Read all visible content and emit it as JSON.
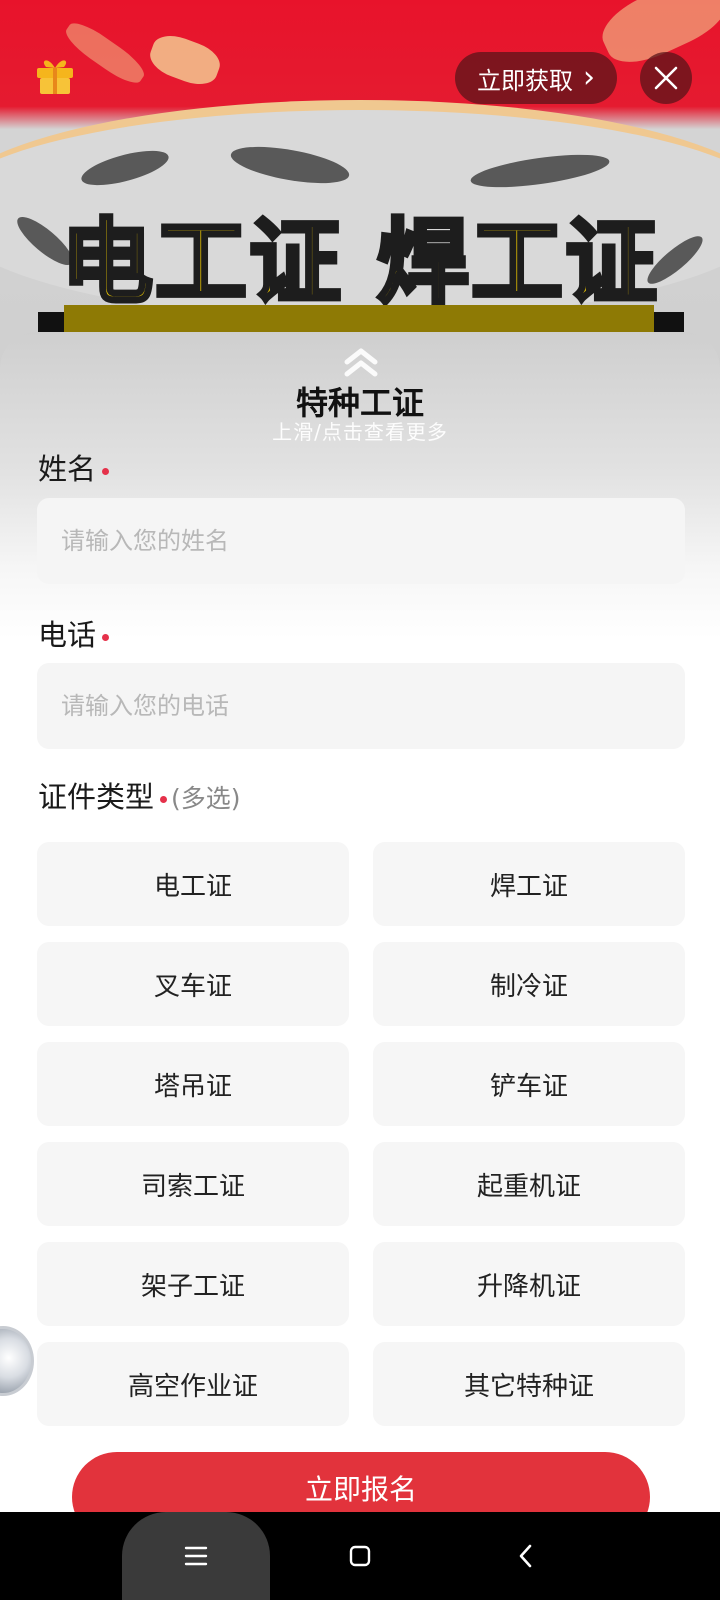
{
  "banner": {
    "headline": "电工证 焊工证",
    "cta_label": "立即获取",
    "cta_chevron": "›"
  },
  "sheet": {
    "title": "特种工证",
    "hint": "上滑/点击查看更多"
  },
  "form": {
    "name": {
      "label": "姓名",
      "placeholder": "请输入您的姓名",
      "value": ""
    },
    "phone": {
      "label": "电话",
      "placeholder": "请输入您的电话",
      "value": ""
    },
    "cert_type": {
      "label": "证件类型",
      "multi_note": "(多选)",
      "options": [
        "电工证",
        "焊工证",
        "叉车证",
        "制冷证",
        "塔吊证",
        "铲车证",
        "司索工证",
        "起重机证",
        "架子工证",
        "升降机证",
        "高空作业证",
        "其它特种证"
      ]
    },
    "submit_label": "立即报名"
  },
  "colors": {
    "banner_red": "#e8132b",
    "required_dot": "#e5314a",
    "submit_red": "#e2333c",
    "headline_yellow": "#e8c400"
  },
  "icons": {
    "gift": "gift-icon",
    "close": "close-icon",
    "handle": "chevron-up-double-icon",
    "nav_menu": "menu-icon",
    "nav_home": "square-icon",
    "nav_back": "back-chevron-icon"
  }
}
